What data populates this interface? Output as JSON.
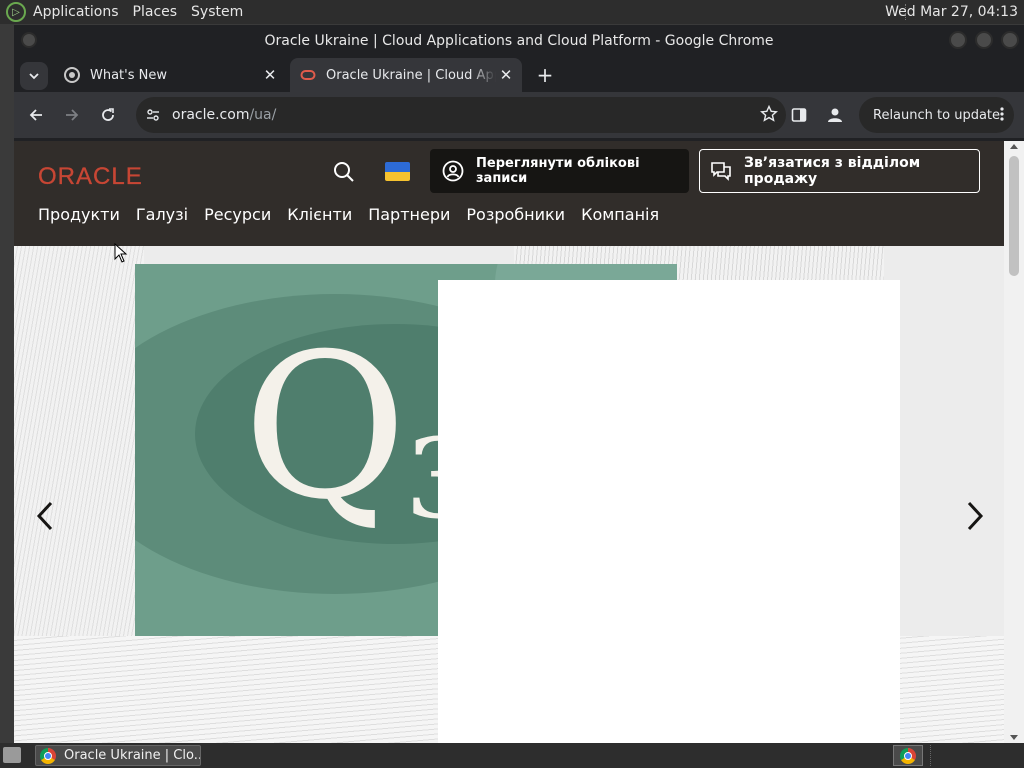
{
  "desktop": {
    "menu": [
      "Applications",
      "Places",
      "System"
    ],
    "clock": "Wed Mar 27, 04:13"
  },
  "window": {
    "title": "Oracle Ukraine | Cloud Applications and Cloud Platform - Google Chrome"
  },
  "tabs": [
    {
      "label": "What's New",
      "icon": "chrome-icon"
    },
    {
      "label": "Oracle Ukraine | Cloud Applications and Cloud Platform",
      "icon": "oracle-favicon-icon",
      "active": true
    }
  ],
  "toolbar": {
    "url_host": "oracle.com",
    "url_path": "/ua/",
    "relaunch_label": "Relaunch to update"
  },
  "site": {
    "logo": "ORACLE",
    "brand_color": "#c74634",
    "accounts_button": "Переглянути облікові записи",
    "sales_button": "Зв’язатися з відділом продажу",
    "nav": [
      "Продукти",
      "Галузі",
      "Ресурси",
      "Клієнти",
      "Партнери",
      "Розробники",
      "Компанія"
    ]
  },
  "hero": {
    "q_letter": "Q",
    "q_number": "3"
  },
  "taskbar": {
    "task_label": "Oracle Ukraine | Clo..."
  }
}
